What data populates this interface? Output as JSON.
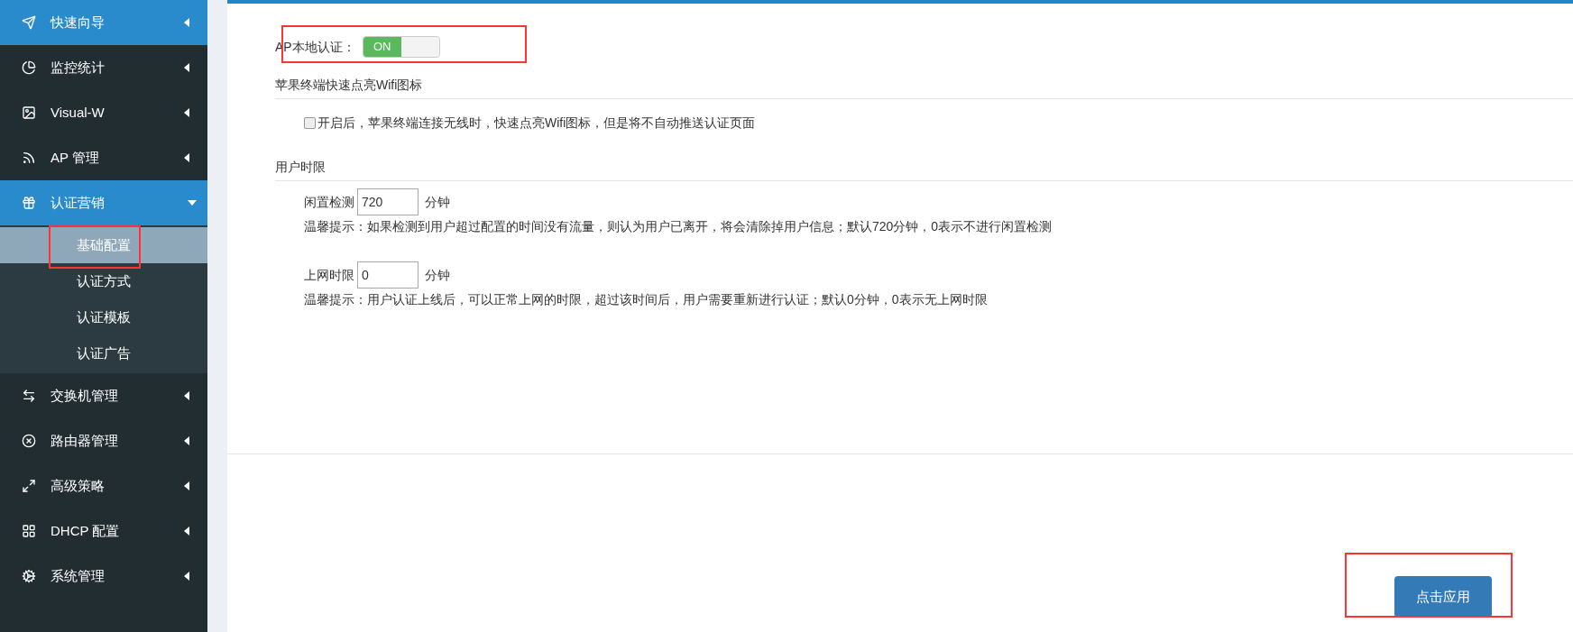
{
  "sidebar": {
    "items": [
      {
        "label": "快速向导",
        "selected": true,
        "expanded": false
      },
      {
        "label": "监控统计",
        "selected": false,
        "expanded": false
      },
      {
        "label": "Visual-W",
        "selected": false,
        "expanded": false
      },
      {
        "label": "AP 管理",
        "selected": false,
        "expanded": false
      },
      {
        "label": "认证营销",
        "selected": true,
        "expanded": true,
        "children": [
          {
            "label": "基础配置",
            "selected": true
          },
          {
            "label": "认证方式",
            "selected": false
          },
          {
            "label": "认证模板",
            "selected": false
          },
          {
            "label": "认证广告",
            "selected": false
          }
        ]
      },
      {
        "label": "交换机管理",
        "selected": false,
        "expanded": false
      },
      {
        "label": "路由器管理",
        "selected": false,
        "expanded": false
      },
      {
        "label": "高级策略",
        "selected": false,
        "expanded": false
      },
      {
        "label": "DHCP 配置",
        "selected": false,
        "expanded": false
      },
      {
        "label": "系统管理",
        "selected": false,
        "expanded": false
      }
    ]
  },
  "ap_auth": {
    "label": "AP本地认证：",
    "toggle_text": "ON",
    "on": true
  },
  "apple_section": {
    "title": "苹果终端快速点亮Wifi图标",
    "checkbox_label": "开启后，苹果终端连接无线时，快速点亮Wifi图标，但是将不自动推送认证页面",
    "checked": false
  },
  "user_limit": {
    "title": "用户时限",
    "fields": [
      {
        "label": "闲置检测",
        "value": "720",
        "unit": "分钟",
        "hint": "温馨提示：如果检测到用户超过配置的时间没有流量，则认为用户已离开，将会清除掉用户信息；默认720分钟，0表示不进行闲置检测"
      },
      {
        "label": "上网时限",
        "value": "0",
        "unit": "分钟",
        "hint": "温馨提示：用户认证上线后，可以正常上网的时限，超过该时间后，用户需要重新进行认证；默认0分钟，0表示无上网时限"
      }
    ]
  },
  "apply_button": "点击应用"
}
